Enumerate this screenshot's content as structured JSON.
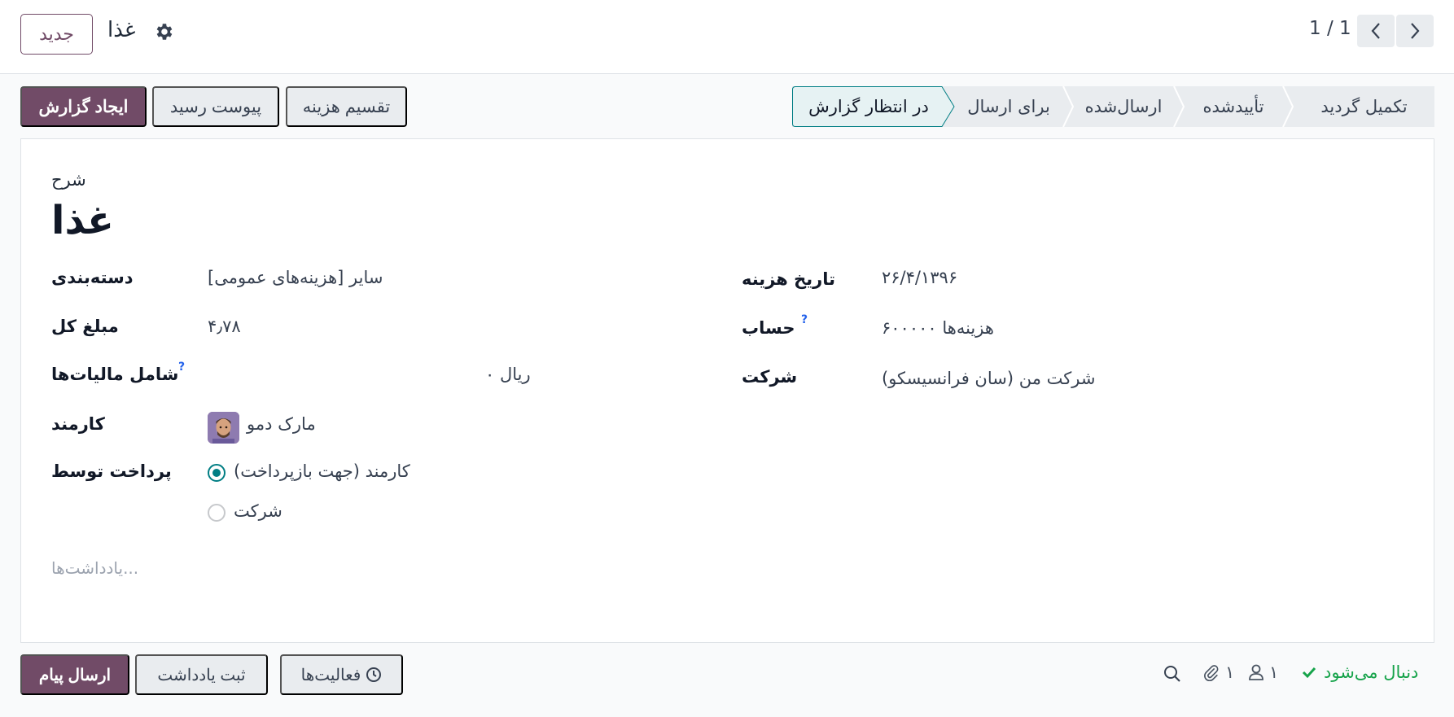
{
  "topbar": {
    "new_label": "جدید",
    "record_title": "غذا",
    "pager": "1 / 1"
  },
  "actions": {
    "create_report": "ایجاد گزارش",
    "attach_receipt": "پیوست رسید",
    "split_expense": "تقسیم هزینه"
  },
  "status": {
    "current": "در انتظار گزارش",
    "stages": [
      "برای ارسال",
      "ارسال‌شده",
      "تأییدشده",
      "تکمیل گردید"
    ]
  },
  "form": {
    "description_label": "شرح",
    "title": "غذا",
    "category_label": "دسته‌بندی",
    "category_value": "[هزینه‌های عمومی] سایر",
    "total_label": "مبلغ کل",
    "total_value": "۴٫۷۸",
    "tax_label": "شامل مالیات‌ها",
    "tax_value": "۰ ریال",
    "employee_label": "کارمند",
    "employee_value": "مارک دمو",
    "paid_by_label": "پرداخت توسط",
    "paid_by_options": [
      "کارمند (جهت بازپرداخت)",
      "شرکت"
    ],
    "date_label": "تاریخ هزینه",
    "date_value": "۲۶/۴/۱۳۹۶",
    "account_label": "حساب",
    "account_value": "۶۰۰۰۰۰ هزینه‌ها",
    "company_label": "شرکت",
    "company_value": "شرکت من (سان فرانسیسکو)",
    "help_mark": "?",
    "notes_placeholder": "یادداشت‌ها..."
  },
  "chatter": {
    "send_message": "ارسال پیام",
    "log_note": "ثبت یادداشت",
    "activities": "فعالیت‌ها",
    "following": "دنبال می‌شود",
    "followers_count": "۱",
    "attachments_count": "۱"
  },
  "colors": {
    "primary": "#714b67",
    "accent": "#017e84",
    "success": "#16a34a"
  }
}
